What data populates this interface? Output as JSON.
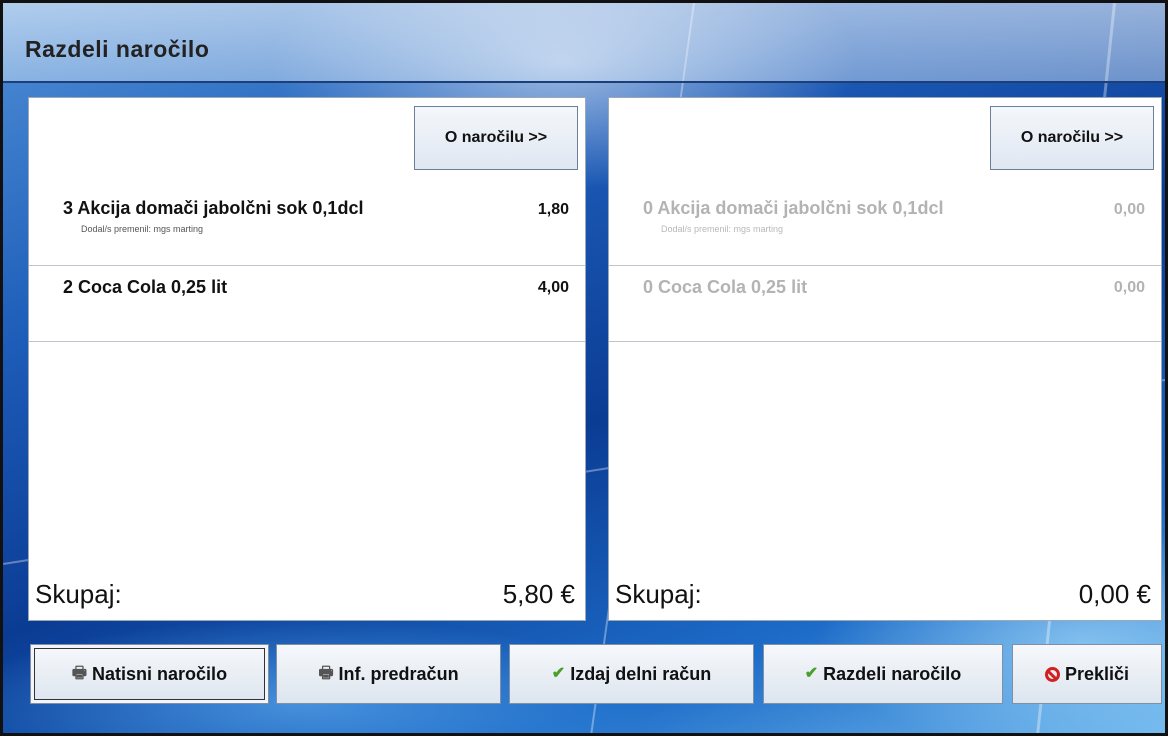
{
  "window": {
    "title": "Razdeli naročilo"
  },
  "left_panel": {
    "about_button_label": "O naročilu >>",
    "items": [
      {
        "name": "3 Akcija domači jabolčni sok 0,1dcl",
        "sub": "Dodal/s premenil: mgs marting",
        "price": "1,80"
      },
      {
        "name": "2 Coca Cola 0,25 lit",
        "sub": "",
        "price": "4,00"
      }
    ],
    "total_label": "Skupaj:",
    "total_value": "5,80 €"
  },
  "right_panel": {
    "about_button_label": "O naročilu >>",
    "items": [
      {
        "name": "0 Akcija domači jabolčni sok 0,1dcl",
        "sub": "Dodal/s premenil: mgs marting",
        "price": "0,00"
      },
      {
        "name": "0 Coca Cola 0,25 lit",
        "sub": "",
        "price": "0,00"
      }
    ],
    "total_label": "Skupaj:",
    "total_value": "0,00 €"
  },
  "buttons": {
    "print_order": {
      "label": "Natisni naročilo",
      "icon": "printer-icon"
    },
    "info_invoice": {
      "label": "Inf. predračun",
      "icon": "printer-icon"
    },
    "partial_invoice": {
      "label": "Izdaj delni račun",
      "icon": "check-icon"
    },
    "split_order": {
      "label": "Razdeli naročilo",
      "icon": "check-icon"
    },
    "cancel": {
      "label": "Prekliči",
      "icon": "cancel-icon"
    }
  },
  "colors": {
    "disabled_text": "#b3b3b3",
    "check_green": "#4aa02c",
    "cancel_red": "#d21f1f"
  }
}
